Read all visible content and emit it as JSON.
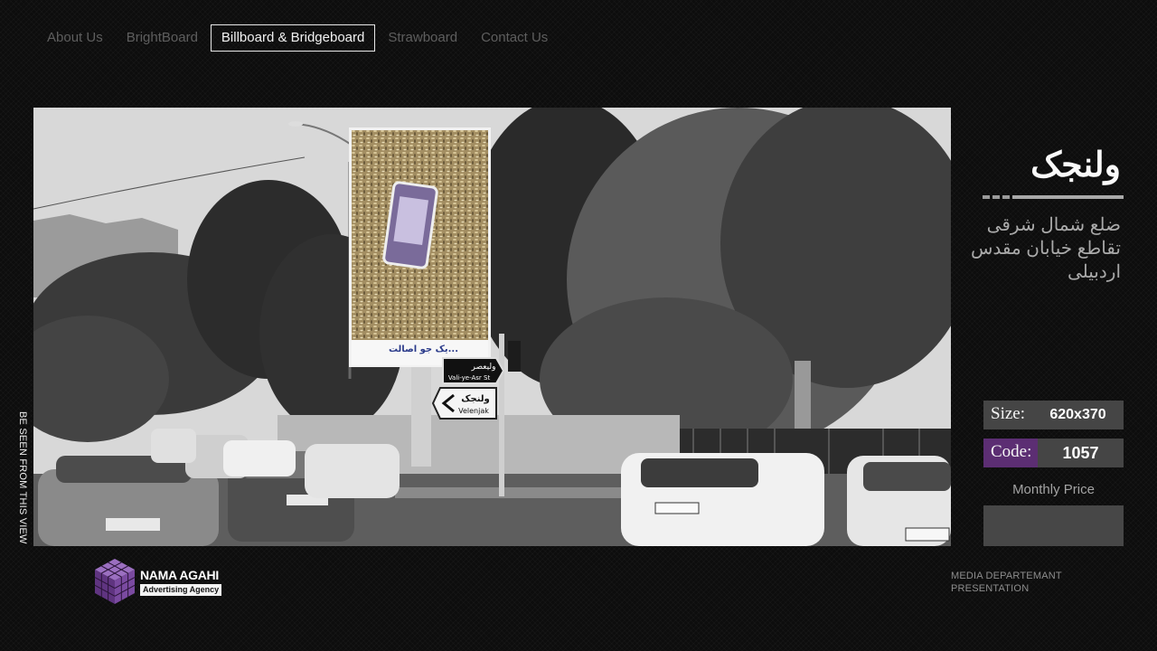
{
  "nav": {
    "items": [
      {
        "label": "About Us",
        "active": false
      },
      {
        "label": "BrightBoard",
        "active": false
      },
      {
        "label": "Billboard & Bridgeboard",
        "active": true
      },
      {
        "label": "Strawboard",
        "active": false
      },
      {
        "label": "Contact Us",
        "active": false
      }
    ]
  },
  "photo": {
    "caption": "BE SEEN FROM THIS VIEW",
    "billboard_slogan": "یک جو اصالت...",
    "sign_street_fa": "ولیعصر",
    "sign_street_en": "Vali-ye-Asr St",
    "sign_direction_fa": "ولنجک",
    "sign_direction_en": "Velenjak"
  },
  "info": {
    "title": "ولنجک",
    "address": "ضلع شمال شرقی تقاطع خیابان مقدس اردبیلی",
    "size_label": "Size:",
    "size_value": "620x370",
    "code_label": "Code:",
    "code_value": "1057",
    "monthly_label": "Monthly Price",
    "monthly_value": ""
  },
  "footer": {
    "logo_name": "NAMA AGAHI",
    "logo_tagline": "Advertising Agency",
    "note_line1": "MEDIA DEPARTEMANT",
    "note_line2": "PRESENTATION"
  },
  "colors": {
    "background": "#0d0d0d",
    "accent_purple": "#5c2e73",
    "panel_gray": "#454545"
  }
}
